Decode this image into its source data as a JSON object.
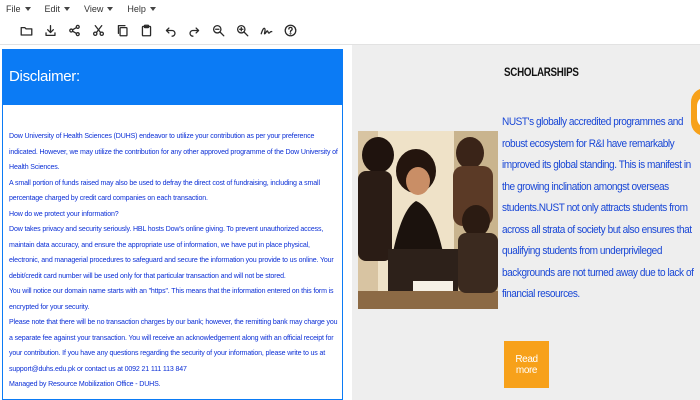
{
  "menubar": {
    "items": [
      {
        "label": "File"
      },
      {
        "label": "Edit"
      },
      {
        "label": "View"
      },
      {
        "label": "Help"
      }
    ]
  },
  "toolbar": {
    "icons": [
      "folder-icon",
      "download-icon",
      "share-icon",
      "cut-icon",
      "copy-icon",
      "paste-icon",
      "undo-icon",
      "redo-icon",
      "zoom-out-icon",
      "zoom-in-icon",
      "signature-icon",
      "help-icon"
    ]
  },
  "disclaimer": {
    "title": "Disclaimer:",
    "paragraphs": [
      "Dow University of Health Sciences (DUHS) endeavor to utilize your contribution as per your preference indicated. However, we may utilize the contribution for any other approved programme of the Dow University of Health Sciences.",
      "A small portion of funds raised may also be used to defray the direct cost of fundraising, including a small percentage charged by credit card companies on each transaction.",
      "How do we protect your information?",
      "Dow takes privacy and security seriously. HBL hosts Dow's online giving. To prevent unauthorized access, maintain data accuracy, and ensure the appropriate use of information, we have put in place physical, electronic, and managerial procedures to safeguard and secure the information you provide to us online. Your debit/credit card number will be used only for that particular transaction and will not be stored.",
      "You will notice our domain name starts with an \"https\". This means that the information entered on this form is encrypted for your security.",
      "Please note that there will be no transaction charges by our bank; however, the remitting bank may charge you a separate fee against your transaction. You will receive an acknowledgement along with an official receipt for your contribution. If you have any questions regarding the security of your information, please write to us at support@duhs.edu.pk or contact us at 0092 21 111 113 847",
      "Managed by Resource Mobilization Office - DUHS."
    ]
  },
  "scholarships": {
    "title": "SCHOLARSHIPS",
    "body": "NUST's globally accredited programmes and robust ecosystem for R&I have remarkably improved its global standing. This is manifest in the growing inclination amongst overseas students.NUST not only attracts students from across all strata of society but also ensures that qualifying students from underprivileged backgrounds are not turned away due to lack of financial resources.",
    "button_label": "Read more"
  },
  "colors": {
    "primary": "#0b7bf5",
    "text_blue": "#0b2fd6",
    "accent": "#f7a11a",
    "panel_bg": "#eeeeee"
  }
}
